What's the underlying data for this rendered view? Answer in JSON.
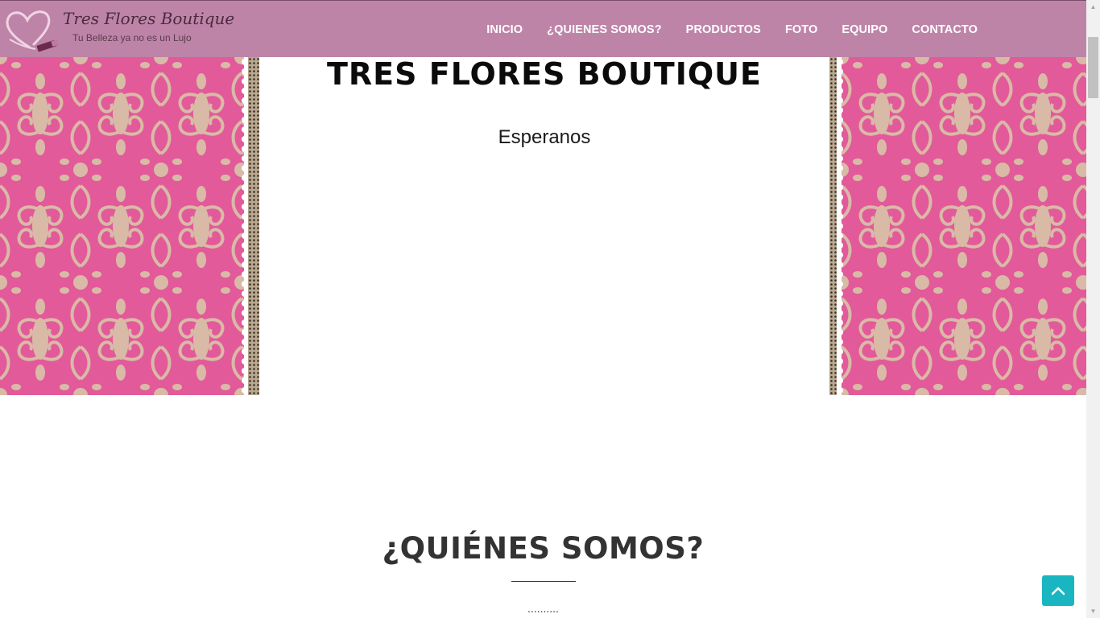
{
  "brand": {
    "title": "Tres Flores Boutique",
    "tagline": "Tu Belleza ya no es un Lujo",
    "colors": {
      "header": "#be84a8",
      "accent": "#19b6c1",
      "damask": "#e25a9a"
    }
  },
  "nav": {
    "items": [
      {
        "label": "INICIO"
      },
      {
        "label": "¿QUIENES SOMOS?"
      },
      {
        "label": "PRODUCTOS"
      },
      {
        "label": "FOTO"
      },
      {
        "label": "EQUIPO"
      },
      {
        "label": "CONTACTO"
      }
    ]
  },
  "hero": {
    "title": "TRES FLORES BOUTIQUE",
    "subtitle": "Esperanos"
  },
  "about": {
    "title": "¿QUIÉNES SOMOS?",
    "dots": ".........."
  },
  "icons": {
    "back_to_top": "chevron-up-icon",
    "logo": "heart-lipstick-icon"
  }
}
